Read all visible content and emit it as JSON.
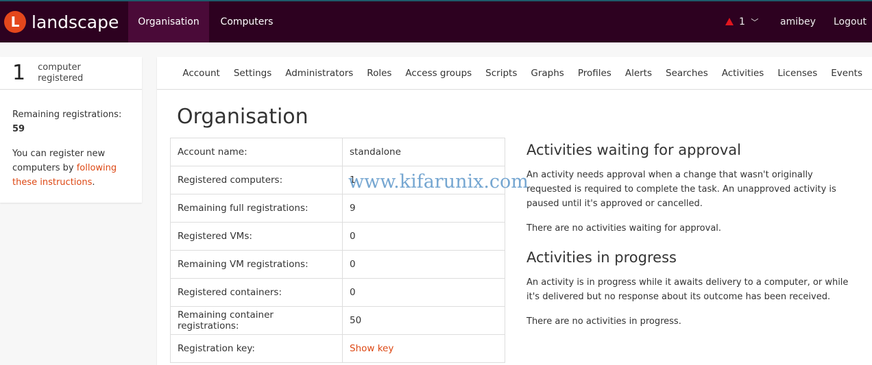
{
  "header": {
    "logo_text": "landscape",
    "logo_letter": "L",
    "tabs": [
      {
        "label": "Organisation",
        "active": true
      },
      {
        "label": "Computers",
        "active": false
      }
    ],
    "alerts_count": "1",
    "user": "amibey",
    "logout": "Logout",
    "alert_color": "#e0161e"
  },
  "sidebar": {
    "count": "1",
    "count_label_1": "computer",
    "count_label_2": "registered",
    "remaining_label": "Remaining registrations:",
    "remaining_value": "59",
    "register_text": "You can register new computers by ",
    "register_link": "following these instructions",
    "register_end": "."
  },
  "subnav": [
    "Account",
    "Settings",
    "Administrators",
    "Roles",
    "Access groups",
    "Scripts",
    "Graphs",
    "Profiles",
    "Alerts",
    "Searches",
    "Activities",
    "Licenses",
    "Events"
  ],
  "main": {
    "title": "Organisation",
    "rows": [
      {
        "label": "Account name:",
        "value": "standalone"
      },
      {
        "label": "Registered computers:",
        "value": "1"
      },
      {
        "label": "Remaining full registrations:",
        "value": "9"
      },
      {
        "label": "Registered VMs:",
        "value": "0"
      },
      {
        "label": "Remaining VM registrations:",
        "value": "0"
      },
      {
        "label": "Registered containers:",
        "value": "0"
      },
      {
        "label": "Remaining container registrations:",
        "value": "50"
      },
      {
        "label": "Registration key:",
        "value": "Show key"
      }
    ]
  },
  "activities": {
    "waiting_title": "Activities waiting for approval",
    "waiting_desc": "An activity needs approval when a change that wasn't originally requested is required to complete the task. An unapproved activity is paused until it's approved or cancelled.",
    "waiting_none": "There are no activities waiting for approval.",
    "progress_title": "Activities in progress",
    "progress_desc": "An activity is in progress while it awaits delivery to a computer, or while it's delivered but no response about its outcome has been received.",
    "progress_none": "There are no activities in progress."
  },
  "watermark": "www.kifarunix.com",
  "accent": "#dd4814"
}
